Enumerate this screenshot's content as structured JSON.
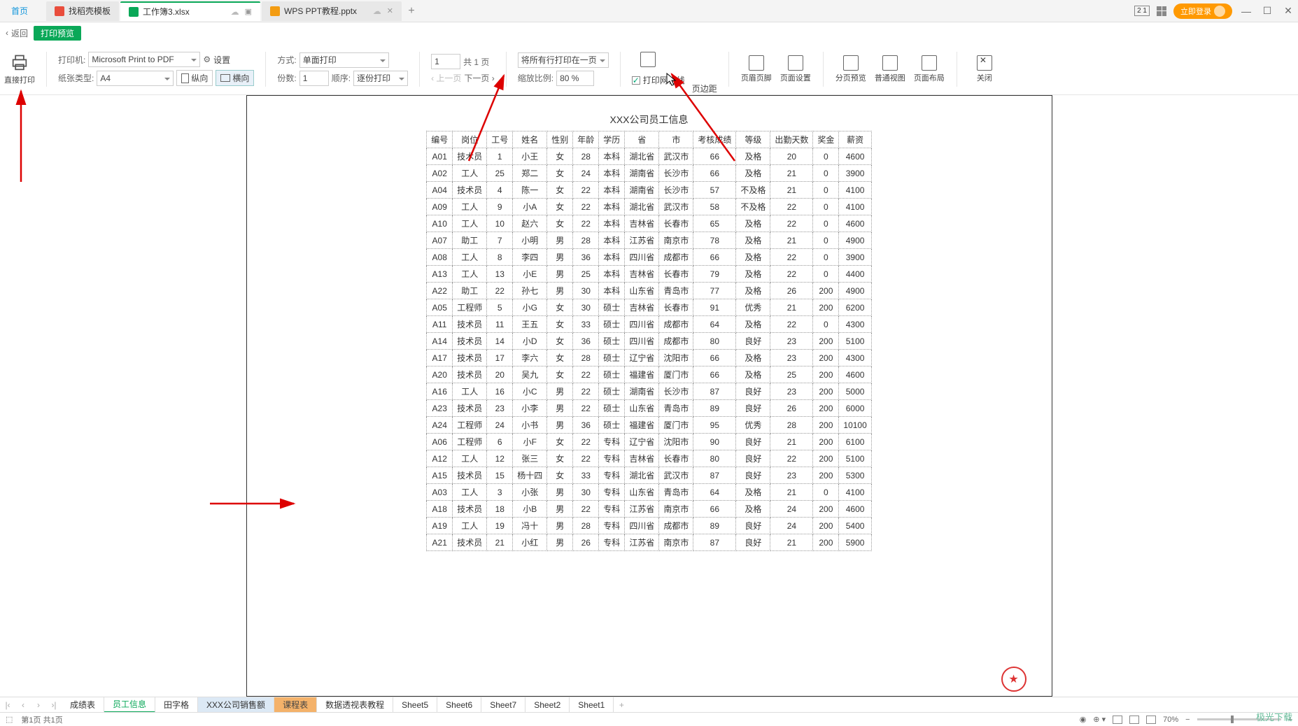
{
  "tabs": {
    "home": "首页",
    "t1": "找稻壳模板",
    "t2": "工作簿3.xlsx",
    "t3": "WPS PPT教程.pptx"
  },
  "topright": {
    "login": "立即登录",
    "num21": "2 1"
  },
  "subbar": {
    "back": "返回",
    "badge": "打印预览"
  },
  "toolbar": {
    "direct_print": "直接打印",
    "printer_lbl": "打印机:",
    "printer_val": "Microsoft Print to PDF",
    "settings": "设置",
    "paper_lbl": "纸张类型:",
    "paper_val": "A4",
    "portrait": "纵向",
    "landscape": "横向",
    "mode_lbl": "方式:",
    "mode_val": "单面打印",
    "copies_lbl": "份数:",
    "copies_val": "1",
    "order_lbl": "顺序:",
    "order_val": "逐份打印",
    "page_num": "1",
    "page_total": "共 1 页",
    "prev": "上一页",
    "next": "下一页",
    "fit_val": "将所有行打印在一页",
    "zoom_lbl": "缩放比例:",
    "zoom_val": "80 %",
    "grid_chk": "打印网格线",
    "margin": "页边距",
    "headerfooter": "页眉页脚",
    "pagesetup": "页面设置",
    "pagebreak": "分页预览",
    "normalview": "普通视图",
    "layoutview": "页面布局",
    "close": "关闭"
  },
  "page_title": "XXX公司员工信息",
  "headers": [
    "编号",
    "岗位",
    "工号",
    "姓名",
    "性别",
    "年龄",
    "学历",
    "省",
    "市",
    "考核成绩",
    "等级",
    "出勤天数",
    "奖金",
    "薪资"
  ],
  "rows": [
    [
      "A01",
      "技术员",
      "1",
      "小王",
      "女",
      "28",
      "本科",
      "湖北省",
      "武汉市",
      "66",
      "及格",
      "20",
      "0",
      "4600"
    ],
    [
      "A02",
      "工人",
      "25",
      "郑二",
      "女",
      "24",
      "本科",
      "湖南省",
      "长沙市",
      "66",
      "及格",
      "21",
      "0",
      "3900"
    ],
    [
      "A04",
      "技术员",
      "4",
      "陈一",
      "女",
      "22",
      "本科",
      "湖南省",
      "长沙市",
      "57",
      "不及格",
      "21",
      "0",
      "4100"
    ],
    [
      "A09",
      "工人",
      "9",
      "小A",
      "女",
      "22",
      "本科",
      "湖北省",
      "武汉市",
      "58",
      "不及格",
      "22",
      "0",
      "4100"
    ],
    [
      "A10",
      "工人",
      "10",
      "赵六",
      "女",
      "22",
      "本科",
      "吉林省",
      "长春市",
      "65",
      "及格",
      "22",
      "0",
      "4600"
    ],
    [
      "A07",
      "助工",
      "7",
      "小明",
      "男",
      "28",
      "本科",
      "江苏省",
      "南京市",
      "78",
      "及格",
      "21",
      "0",
      "4900"
    ],
    [
      "A08",
      "工人",
      "8",
      "李四",
      "男",
      "36",
      "本科",
      "四川省",
      "成都市",
      "66",
      "及格",
      "22",
      "0",
      "3900"
    ],
    [
      "A13",
      "工人",
      "13",
      "小E",
      "男",
      "25",
      "本科",
      "吉林省",
      "长春市",
      "79",
      "及格",
      "22",
      "0",
      "4400"
    ],
    [
      "A22",
      "助工",
      "22",
      "孙七",
      "男",
      "30",
      "本科",
      "山东省",
      "青岛市",
      "77",
      "及格",
      "26",
      "200",
      "4900"
    ],
    [
      "A05",
      "工程师",
      "5",
      "小G",
      "女",
      "30",
      "硕士",
      "吉林省",
      "长春市",
      "91",
      "优秀",
      "21",
      "200",
      "6200"
    ],
    [
      "A11",
      "技术员",
      "11",
      "王五",
      "女",
      "33",
      "硕士",
      "四川省",
      "成都市",
      "64",
      "及格",
      "22",
      "0",
      "4300"
    ],
    [
      "A14",
      "技术员",
      "14",
      "小D",
      "女",
      "36",
      "硕士",
      "四川省",
      "成都市",
      "80",
      "良好",
      "23",
      "200",
      "5100"
    ],
    [
      "A17",
      "技术员",
      "17",
      "李六",
      "女",
      "28",
      "硕士",
      "辽宁省",
      "沈阳市",
      "66",
      "及格",
      "23",
      "200",
      "4300"
    ],
    [
      "A20",
      "技术员",
      "20",
      "吴九",
      "女",
      "22",
      "硕士",
      "福建省",
      "厦门市",
      "66",
      "及格",
      "25",
      "200",
      "4600"
    ],
    [
      "A16",
      "工人",
      "16",
      "小C",
      "男",
      "22",
      "硕士",
      "湖南省",
      "长沙市",
      "87",
      "良好",
      "23",
      "200",
      "5000"
    ],
    [
      "A23",
      "技术员",
      "23",
      "小李",
      "男",
      "22",
      "硕士",
      "山东省",
      "青岛市",
      "89",
      "良好",
      "26",
      "200",
      "6000"
    ],
    [
      "A24",
      "工程师",
      "24",
      "小书",
      "男",
      "36",
      "硕士",
      "福建省",
      "厦门市",
      "95",
      "优秀",
      "28",
      "200",
      "10100"
    ],
    [
      "A06",
      "工程师",
      "6",
      "小F",
      "女",
      "22",
      "专科",
      "辽宁省",
      "沈阳市",
      "90",
      "良好",
      "21",
      "200",
      "6100"
    ],
    [
      "A12",
      "工人",
      "12",
      "张三",
      "女",
      "22",
      "专科",
      "吉林省",
      "长春市",
      "80",
      "良好",
      "22",
      "200",
      "5100"
    ],
    [
      "A15",
      "技术员",
      "15",
      "杨十四",
      "女",
      "33",
      "专科",
      "湖北省",
      "武汉市",
      "87",
      "良好",
      "23",
      "200",
      "5300"
    ],
    [
      "A03",
      "工人",
      "3",
      "小张",
      "男",
      "30",
      "专科",
      "山东省",
      "青岛市",
      "64",
      "及格",
      "21",
      "0",
      "4100"
    ],
    [
      "A18",
      "技术员",
      "18",
      "小B",
      "男",
      "22",
      "专科",
      "江苏省",
      "南京市",
      "66",
      "及格",
      "24",
      "200",
      "4600"
    ],
    [
      "A19",
      "工人",
      "19",
      "冯十",
      "男",
      "28",
      "专科",
      "四川省",
      "成都市",
      "89",
      "良好",
      "24",
      "200",
      "5400"
    ],
    [
      "A21",
      "技术员",
      "21",
      "小红",
      "男",
      "26",
      "专科",
      "江苏省",
      "南京市",
      "87",
      "良好",
      "21",
      "200",
      "5900"
    ]
  ],
  "sheets": [
    "成绩表",
    "员工信息",
    "田字格",
    "XXX公司销售额",
    "课程表",
    "数据透视表教程",
    "Sheet5",
    "Sheet6",
    "Sheet7",
    "Sheet2",
    "Sheet1"
  ],
  "active_sheet": 1,
  "status": {
    "page": "第1页 共1页",
    "zoom": "70%"
  },
  "watermark": "极光下载"
}
